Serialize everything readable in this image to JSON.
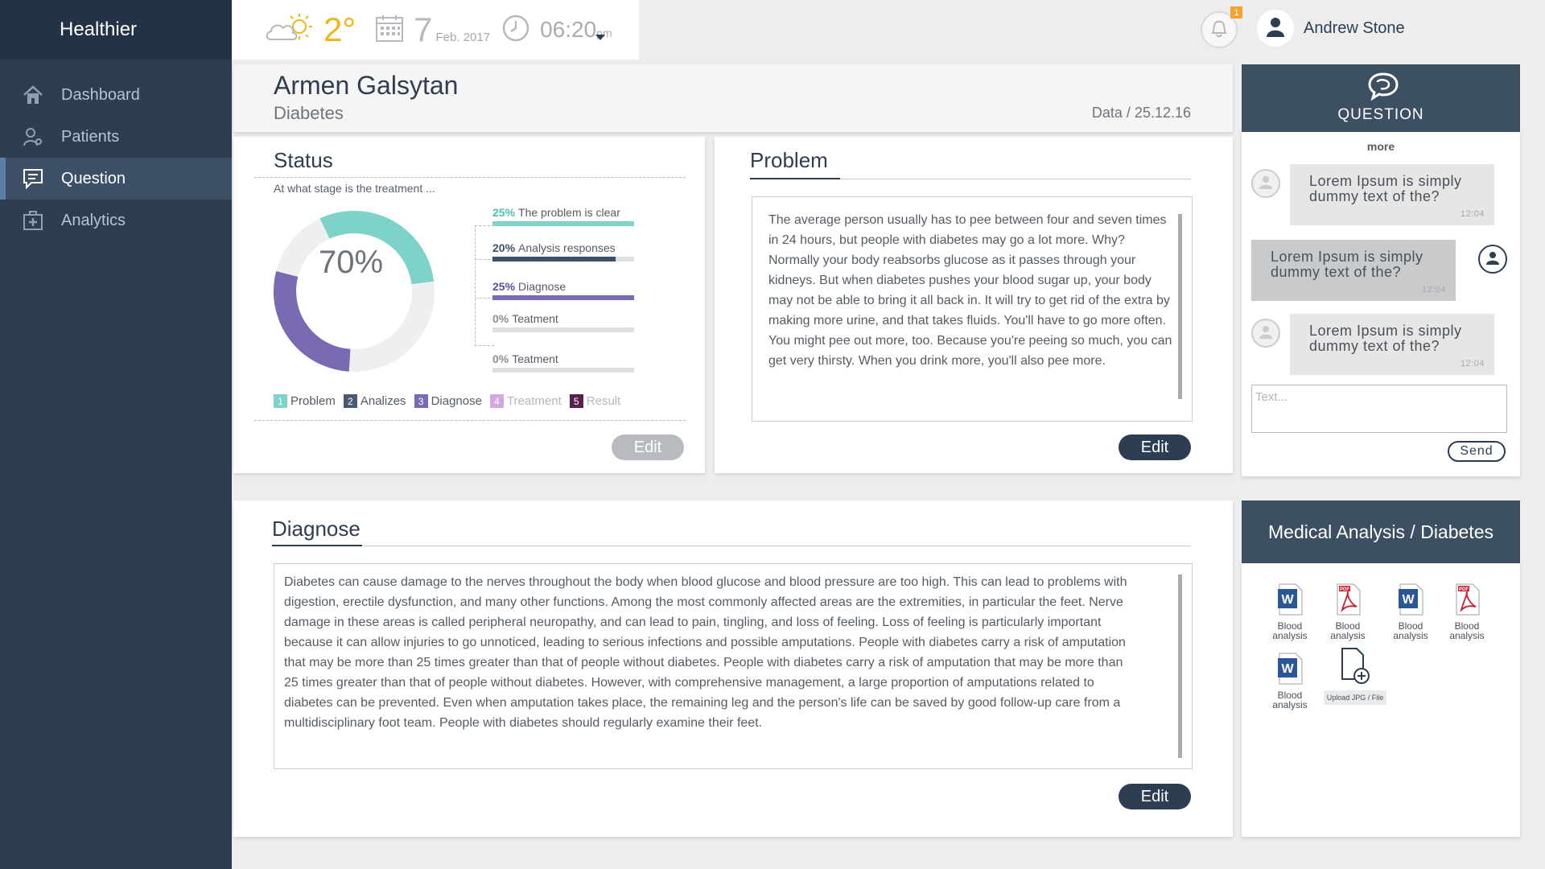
{
  "app": {
    "title": "Healthier"
  },
  "sidebar": {
    "items": [
      {
        "label": "Dashboard",
        "icon": "home-icon"
      },
      {
        "label": "Patients",
        "icon": "patients-icon"
      },
      {
        "label": "Question",
        "icon": "chat-icon",
        "active": true
      },
      {
        "label": "Analytics",
        "icon": "medical-kit-icon"
      }
    ]
  },
  "topbar": {
    "temperature": "2°",
    "day": "7",
    "month": "Feb. 2017",
    "time": "06:20",
    "time_suffix": "pm",
    "notification_count": "1",
    "user_name": "Andrew Stone"
  },
  "patient": {
    "name": "Armen Galsytan",
    "condition": "Diabetes",
    "date": "Data / 25.12.16"
  },
  "status": {
    "title": "Status",
    "question": "At what stage is the treatment ...",
    "donut_percent": "70%",
    "donut_value": 0.7,
    "bars": [
      {
        "pct": "25%",
        "label": "The problem is clear",
        "fill": 1.0,
        "color": "#7ed3c8",
        "pct_color": "#4fbfb0"
      },
      {
        "pct": "20%",
        "label": "Analysis responses",
        "fill": 0.87,
        "color": "#3f5168",
        "pct_color": "#3f5168"
      },
      {
        "pct": "25%",
        "label": "Diagnose",
        "fill": 1.0,
        "color": "#7a6ab3",
        "pct_color": "#5b4e99"
      },
      {
        "pct": "0%",
        "label": "Teatment",
        "fill": 0.0,
        "color": "#c8a4d8",
        "pct_color": "#8d9196"
      },
      {
        "pct": "0%",
        "label": "Teatment",
        "fill": 0.0,
        "color": "#5a1f4a",
        "pct_color": "#8d9196"
      }
    ],
    "legend": [
      {
        "num": "1",
        "label": "Problem",
        "color": "#7ed3c8",
        "muted": false
      },
      {
        "num": "2",
        "label": "Analizes",
        "color": "#4a5b70",
        "muted": false
      },
      {
        "num": "3",
        "label": "Diagnose",
        "color": "#7a6ab3",
        "muted": false
      },
      {
        "num": "4",
        "label": "Treatment",
        "color": "#d6a6e0",
        "muted": true
      },
      {
        "num": "5",
        "label": "Result",
        "color": "#5a1f4a",
        "muted": true
      }
    ],
    "edit_label": "Edit"
  },
  "problem": {
    "title": "Problem",
    "text": "The average person usually has to pee between four and seven times in 24 hours, but people with diabetes may go a lot more. Why? Normally your body reabsorbs glucose as it passes through your kidneys. But when diabetes pushes your blood sugar up, your body may not be able to bring it all back in. It will try to get rid of the extra by making more urine, and that takes fluids. You'll have to go more often. You might pee out more, too. Because you're peeing so much, you can get very thirsty. When you drink more, you'll also pee more.",
    "edit_label": "Edit"
  },
  "diagnose": {
    "title": "Diagnose",
    "text": "Diabetes can cause damage to the nerves throughout the body when blood glucose and blood pressure are too high. This can lead to problems with digestion, erectile dysfunction, and many other functions. Among the most commonly affected areas are the extremities, in particular the feet. Nerve damage in these areas is called peripheral neuropathy, and can lead to pain, tingling, and loss of feeling. Loss of feeling is particularly important because it can allow injuries to go unnoticed, leading to serious infections and possible amputations. People with diabetes carry a risk of amputation that may be more than 25 times greater than that of people without diabetes. People with diabetes carry a risk of amputation that may be more than 25 times greater than that of people without diabetes. However, with comprehensive management, a large proportion of amputations related to diabetes can be prevented. Even when amputation takes place, the remaining leg and the person's life can be saved by good follow-up care from a multidisciplinary foot team. People with diabetes should regularly examine their feet.",
    "edit_label": "Edit"
  },
  "question": {
    "title": "QUESTION",
    "more": "more",
    "messages": [
      {
        "text": "Lorem Ipsum is simply dummy text of the?",
        "time": "12:04"
      },
      {
        "text": "Lorem Ipsum is simply dummy text of the?",
        "time": "12:04"
      },
      {
        "text": "Lorem Ipsum is simply dummy text of the?",
        "time": "12:04"
      }
    ],
    "input_placeholder": "Text...",
    "send_label": "Send"
  },
  "medical_analysis": {
    "title": "Medical Analysis / Diabetes",
    "files": [
      {
        "label": "Blood analysis",
        "type": "word"
      },
      {
        "label": "Blood analysis",
        "type": "pdf"
      },
      {
        "label": "Blood analysis",
        "type": "word"
      },
      {
        "label": "Blood analysis",
        "type": "pdf"
      },
      {
        "label": "Blood analysis",
        "type": "word"
      }
    ],
    "upload_label": "Upload JPG / File"
  },
  "colors": {
    "sidebar": "#2d3e52",
    "accent_dark": "#2d3e52",
    "temp": "#f2b418",
    "teal": "#7ed3c8",
    "purple": "#7a6ab3"
  }
}
